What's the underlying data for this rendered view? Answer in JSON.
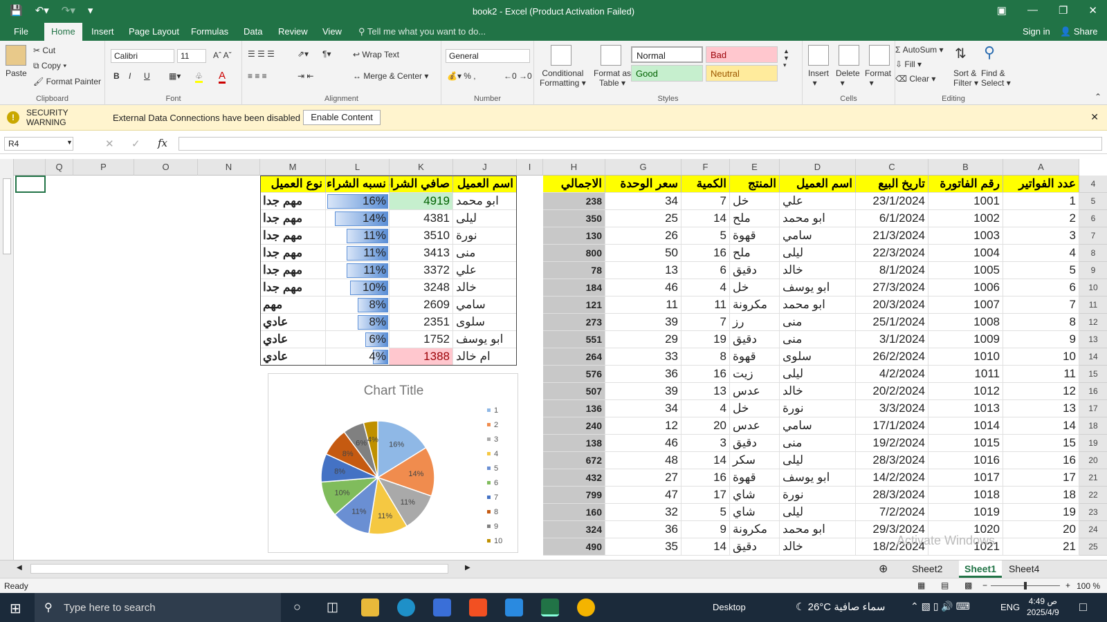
{
  "window": {
    "title": "book2 - Excel (Product Activation Failed)"
  },
  "tabs": [
    "File",
    "Home",
    "Insert",
    "Page Layout",
    "Formulas",
    "Data",
    "Review",
    "View"
  ],
  "tell_me": "Tell me what you want to do...",
  "account": {
    "signin": "Sign in",
    "share": "Share"
  },
  "clipboard": {
    "paste": "Paste",
    "cut": "Cut",
    "copy": "Copy",
    "format_painter": "Format Painter",
    "label": "Clipboard"
  },
  "font": {
    "name": "Calibri",
    "size": "11",
    "label": "Font"
  },
  "alignment": {
    "wrap": "Wrap Text",
    "merge": "Merge & Center",
    "label": "Alignment"
  },
  "number": {
    "format": "General",
    "label": "Number"
  },
  "styles": {
    "cond1": "Conditional",
    "cond2": "Formatting",
    "fat1": "Format as",
    "fat2": "Table",
    "normal": "Normal",
    "bad": "Bad",
    "good": "Good",
    "neutral": "Neutral",
    "label": "Styles"
  },
  "cells": {
    "insert": "Insert",
    "delete": "Delete",
    "format": "Format",
    "label": "Cells"
  },
  "editing": {
    "autosum": "AutoSum",
    "fill": "Fill",
    "clear": "Clear",
    "sort1": "Sort &",
    "sort2": "Filter",
    "find1": "Find &",
    "find2": "Select",
    "label": "Editing"
  },
  "security": {
    "title1": "SECURITY",
    "title2": "WARNING",
    "message": "External Data Connections have been disabled",
    "button": "Enable Content"
  },
  "namebox": "R4",
  "columns": [
    "Q",
    "P",
    "O",
    "N",
    "M",
    "L",
    "K",
    "J",
    "I",
    "H",
    "G",
    "F",
    "E",
    "D",
    "C",
    "B",
    "A"
  ],
  "rows": [
    "4",
    "5",
    "6",
    "7",
    "8",
    "9",
    "10",
    "11",
    "12",
    "13",
    "14",
    "15",
    "16",
    "17",
    "18",
    "19",
    "20",
    "21",
    "22",
    "23",
    "24",
    "25"
  ],
  "main_headers": {
    "a": "عدد الفواتير",
    "b": "رقم الفاتورة",
    "c": "تاريخ البيع",
    "d": "اسم العميل",
    "e": "المنتج",
    "f": "الكمية",
    "g": "سعر الوحدة",
    "h": "الاجمالي"
  },
  "main_rows": [
    [
      "1",
      "1001",
      "23/1/2024",
      "علي",
      "خل",
      "7",
      "34",
      "238"
    ],
    [
      "2",
      "1002",
      "6/1/2024",
      "ابو محمد",
      "ملح",
      "14",
      "25",
      "350"
    ],
    [
      "3",
      "1003",
      "21/3/2024",
      "سامي",
      "قهوة",
      "5",
      "26",
      "130"
    ],
    [
      "4",
      "1004",
      "22/3/2024",
      "ليلى",
      "ملح",
      "16",
      "50",
      "800"
    ],
    [
      "5",
      "1005",
      "8/1/2024",
      "خالد",
      "دقيق",
      "6",
      "13",
      "78"
    ],
    [
      "6",
      "1006",
      "27/3/2024",
      "ابو يوسف",
      "خل",
      "4",
      "46",
      "184"
    ],
    [
      "7",
      "1007",
      "20/3/2024",
      "ابو محمد",
      "مكرونة",
      "11",
      "11",
      "121"
    ],
    [
      "8",
      "1008",
      "25/1/2024",
      "منى",
      "رز",
      "7",
      "39",
      "273"
    ],
    [
      "9",
      "1009",
      "3/1/2024",
      "منى",
      "دقيق",
      "19",
      "29",
      "551"
    ],
    [
      "10",
      "1010",
      "26/2/2024",
      "سلوى",
      "قهوة",
      "8",
      "33",
      "264"
    ],
    [
      "11",
      "1011",
      "4/2/2024",
      "ليلى",
      "زيت",
      "16",
      "36",
      "576"
    ],
    [
      "12",
      "1012",
      "20/2/2024",
      "خالد",
      "عدس",
      "13",
      "39",
      "507"
    ],
    [
      "13",
      "1013",
      "3/3/2024",
      "نورة",
      "خل",
      "4",
      "34",
      "136"
    ],
    [
      "14",
      "1014",
      "17/1/2024",
      "سامي",
      "عدس",
      "20",
      "12",
      "240"
    ],
    [
      "15",
      "1015",
      "19/2/2024",
      "منى",
      "دقيق",
      "3",
      "46",
      "138"
    ],
    [
      "16",
      "1016",
      "28/3/2024",
      "ليلى",
      "سكر",
      "14",
      "48",
      "672"
    ],
    [
      "17",
      "1017",
      "14/2/2024",
      "ابو يوسف",
      "قهوة",
      "16",
      "27",
      "432"
    ],
    [
      "18",
      "1018",
      "28/3/2024",
      "نورة",
      "شاي",
      "17",
      "47",
      "799"
    ],
    [
      "19",
      "1019",
      "7/2/2024",
      "ليلى",
      "شاي",
      "5",
      "32",
      "160"
    ],
    [
      "20",
      "1020",
      "29/3/2024",
      "ابو محمد",
      "مكرونة",
      "9",
      "36",
      "324"
    ],
    [
      "21",
      "1021",
      "18/2/2024",
      "خالد",
      "دقيق",
      "14",
      "35",
      "490"
    ]
  ],
  "summary_headers": {
    "j": "اسم العميل",
    "k": "صافي الشراء",
    "l": "نسبه الشراء",
    "m": "نوع العميل"
  },
  "summary_rows": [
    {
      "j": "ابو محمد",
      "k": "4919",
      "l": "16%",
      "m": "مهم جدا",
      "pct": 16
    },
    {
      "j": "ليلى",
      "k": "4381",
      "l": "14%",
      "m": "مهم جدا",
      "pct": 14
    },
    {
      "j": "نورة",
      "k": "3510",
      "l": "11%",
      "m": "مهم جدا",
      "pct": 11
    },
    {
      "j": "منى",
      "k": "3413",
      "l": "11%",
      "m": "مهم جدا",
      "pct": 11
    },
    {
      "j": "علي",
      "k": "3372",
      "l": "11%",
      "m": "مهم جدا",
      "pct": 11
    },
    {
      "j": "خالد",
      "k": "3248",
      "l": "10%",
      "m": "مهم جدا",
      "pct": 10
    },
    {
      "j": "سامي",
      "k": "2609",
      "l": "8%",
      "m": "مهم",
      "pct": 8
    },
    {
      "j": "سلوى",
      "k": "2351",
      "l": "8%",
      "m": "عادي",
      "pct": 8
    },
    {
      "j": "ابو يوسف",
      "k": "1752",
      "l": "6%",
      "m": "عادي",
      "pct": 6
    },
    {
      "j": "ام خالد",
      "k": "1388",
      "l": "4%",
      "m": "عادي",
      "pct": 4
    }
  ],
  "chart_data": {
    "type": "pie",
    "title": "Chart Title",
    "categories": [
      "1",
      "2",
      "3",
      "4",
      "5",
      "6",
      "7",
      "8",
      "9",
      "10"
    ],
    "values": [
      16,
      14,
      11,
      11,
      11,
      10,
      8,
      8,
      6,
      4
    ],
    "labels": [
      "16%",
      "14%",
      "11%",
      "11%",
      "11%",
      "10%",
      "8%",
      "8%",
      "6%",
      "4%"
    ],
    "colors": [
      "#8fb8e6",
      "#f08c4e",
      "#a9a9a9",
      "#f5c842",
      "#6a8fd3",
      "#80bc5c",
      "#4472c4",
      "#c55a11",
      "#808080",
      "#bf9000"
    ],
    "legend": "right"
  },
  "sheets": [
    "Sheet2",
    "Sheet1",
    "Sheet4"
  ],
  "active_sheet": "Sheet1",
  "status": {
    "ready": "Ready",
    "zoom": "100 %"
  },
  "watermark": "Activate Windows",
  "taskbar": {
    "search": "Type here to search",
    "desktop": "Desktop",
    "weather": "26°C  سماء صافية",
    "lang": "ENG",
    "time": "4:49 ص",
    "date": "2025/4/9"
  }
}
